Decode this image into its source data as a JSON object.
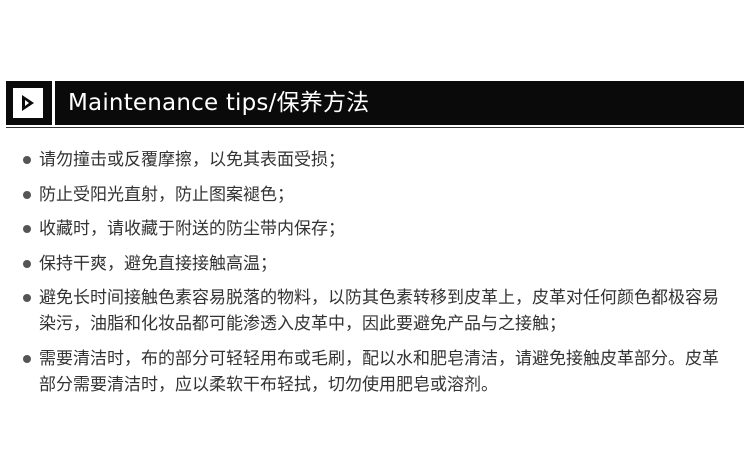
{
  "header": {
    "title": "Maintenance tips/保养方法",
    "icon": "play-icon"
  },
  "tips": [
    "请勿撞击或反覆摩擦，以免其表面受损；",
    "防止受阳光直射，防止图案褪色；",
    "收藏时，请收藏于附送的防尘带内保存；",
    "保持干爽，避免直接接触高温；",
    "避免长时间接触色素容易脱落的物料，以防其色素转移到皮革上，皮革对任何颜色都极容易染污，油脂和化妆品都可能渗透入皮革中，因此要避免产品与之接触；",
    "需要清洁时，布的部分可轻轻用布或毛刷，配以水和肥皂清洁，请避免接触皮革部分。皮革部分需要清洁时，应以柔软干布轻拭，切勿使用肥皂或溶剂。"
  ]
}
